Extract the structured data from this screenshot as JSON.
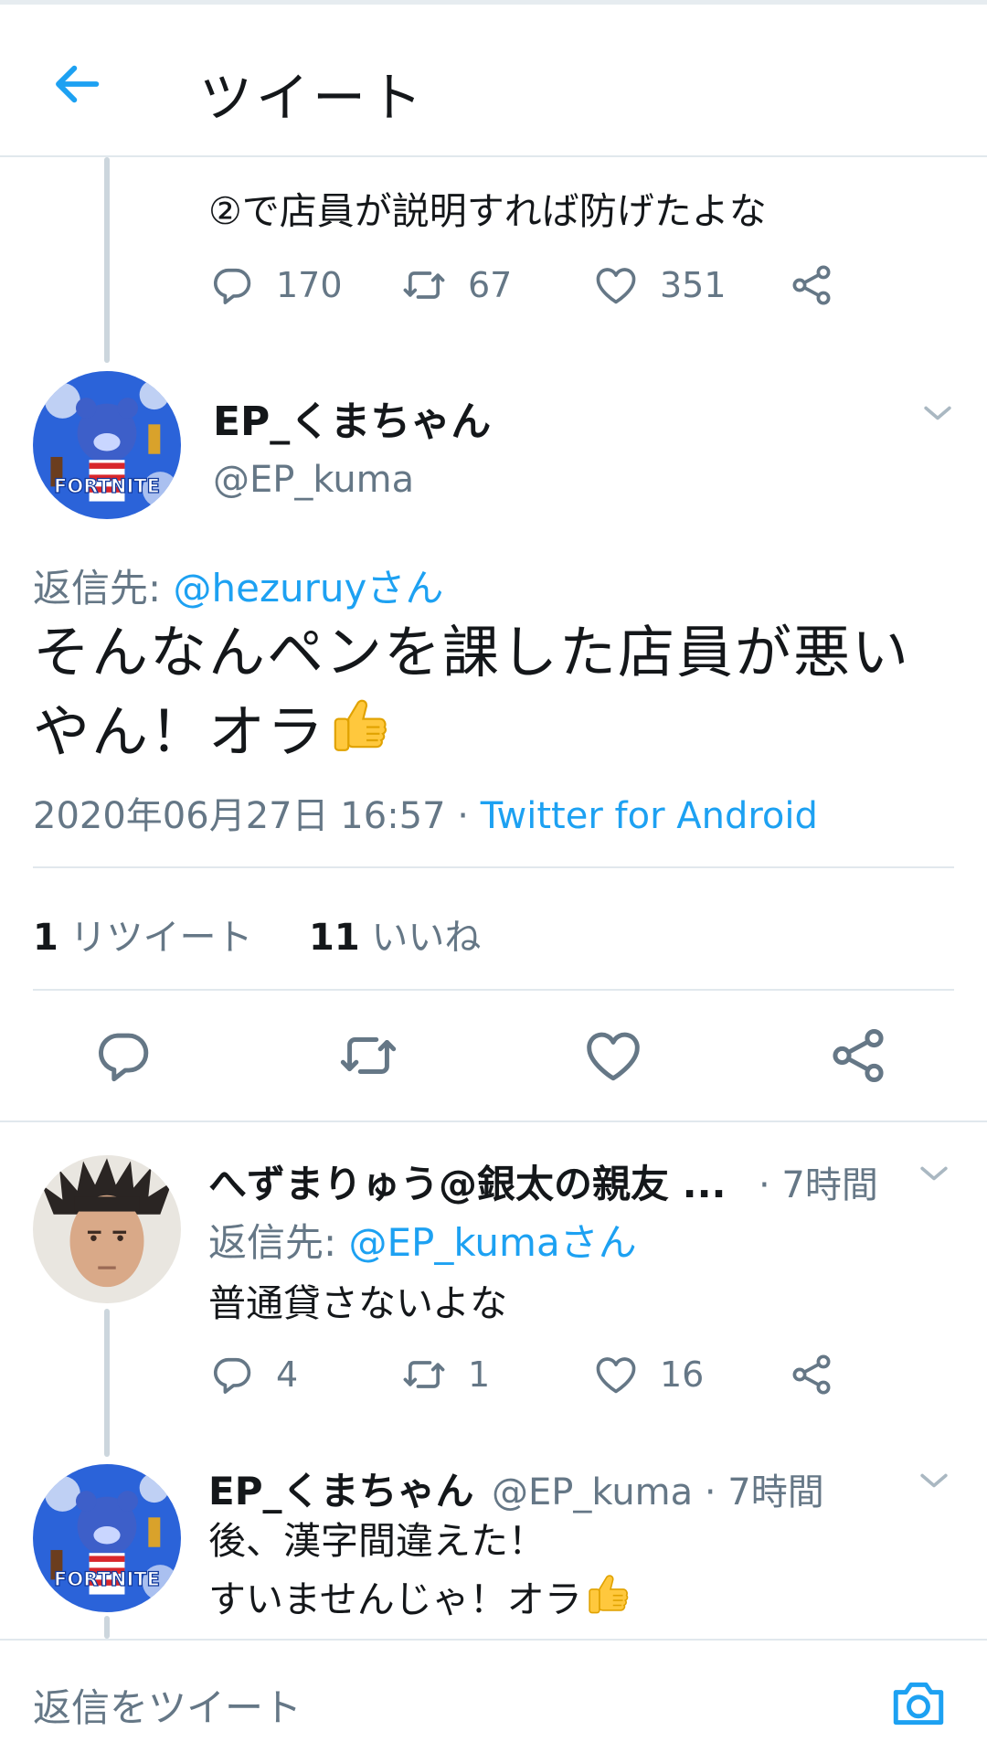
{
  "header": {
    "title": "ツイート"
  },
  "prev_tweet": {
    "text": "②で店員が説明すれば防げたよな",
    "replies": "170",
    "retweets": "67",
    "likes": "351"
  },
  "main_tweet": {
    "name": "EP_くまちゃん",
    "handle": "@EP_kuma",
    "reply_prefix": "返信先: ",
    "reply_mention": "@hezuruyさん",
    "text_line1": "そんなんペンを課した店員が悪い",
    "text_line2": "やん！オラ",
    "timestamp": "2020年06月27日 16:57 · ",
    "source": "Twitter for Android",
    "retweet_count": "1",
    "retweet_label": " リツイート",
    "like_count": "11",
    "like_label": " いいね"
  },
  "reply1": {
    "name": "へずまりゅう@銀太の親友 ...",
    "time": "· 7時間",
    "reply_prefix": "返信先: ",
    "reply_mention": "@EP_kumaさん",
    "text": "普通貸さないよな",
    "replies": "4",
    "retweets": "1",
    "likes": "16"
  },
  "reply2": {
    "name": "EP_くまちゃん",
    "handle_time": "@EP_kuma · 7時間",
    "text_line1": "後、漢字間違えた！",
    "text_line2": "すいませんじゃ！オラ"
  },
  "compose": {
    "placeholder": "返信をツイート"
  },
  "colors": {
    "accent": "#1da1f2",
    "secondary_text": "#657786",
    "divider": "#e1e8ed"
  }
}
